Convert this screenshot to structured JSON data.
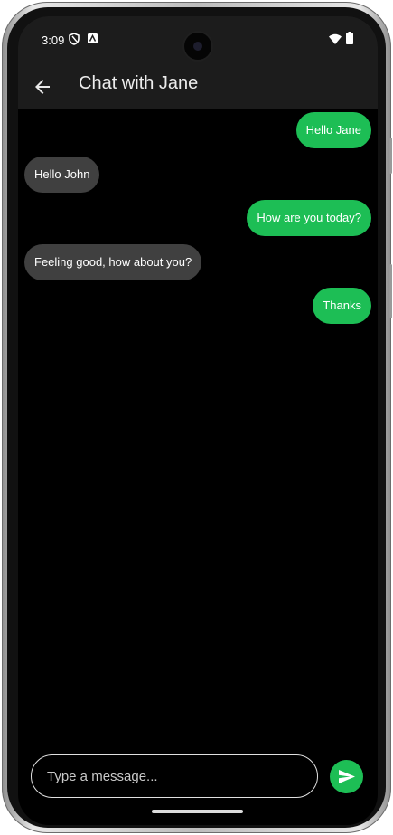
{
  "status_bar": {
    "time": "3:09"
  },
  "app_bar": {
    "title": "Chat with Jane"
  },
  "messages": [
    {
      "text": "Hello Jane",
      "direction": "outgoing"
    },
    {
      "text": "Hello John",
      "direction": "incoming"
    },
    {
      "text": "How are you today?",
      "direction": "outgoing"
    },
    {
      "text": "Feeling good, how about you?",
      "direction": "incoming"
    },
    {
      "text": "Thanks",
      "direction": "outgoing"
    }
  ],
  "composer": {
    "placeholder": "Type a message...",
    "value": ""
  },
  "colors": {
    "accent": "#1dbe55",
    "incoming_bubble": "#404040",
    "app_bar": "#1c1c1c",
    "background": "#000000"
  },
  "icons": {
    "back": "arrow-back-icon",
    "send": "send-icon",
    "wifi": "wifi-icon",
    "battery": "battery-icon"
  }
}
